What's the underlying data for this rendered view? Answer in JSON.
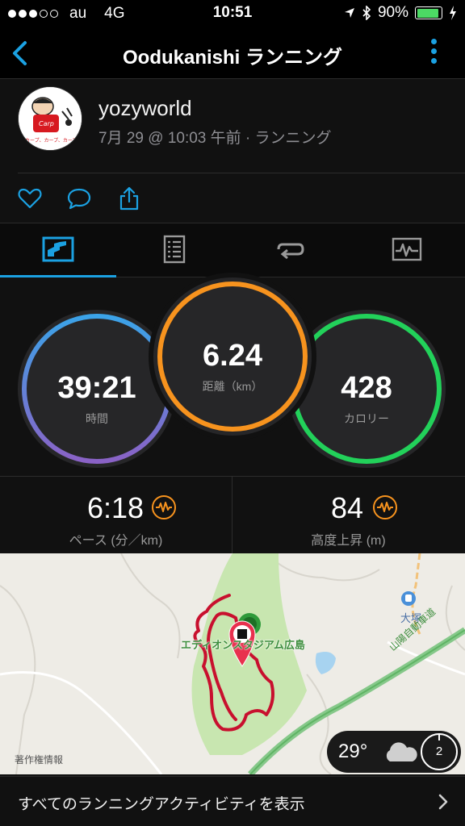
{
  "status_bar": {
    "carrier": "au",
    "network": "4G",
    "time": "10:51",
    "battery": "90%",
    "battery_level": 0.9
  },
  "nav": {
    "title": "Oodukanishi ランニング"
  },
  "activity": {
    "user": "yozyworld",
    "meta": "7月 29 @ 10:03 午前 · ランニング",
    "avatar_text": "カープ、カープ、カープ!!"
  },
  "tabs": [
    {
      "icon": "chart-icon"
    },
    {
      "icon": "splits-icon"
    },
    {
      "icon": "laps-icon"
    },
    {
      "icon": "graph-icon"
    }
  ],
  "rings": {
    "time": {
      "value": "39:21",
      "label": "時間"
    },
    "distance": {
      "value": "6.24",
      "label": "距離（km）"
    },
    "calories": {
      "value": "428",
      "label": "カロリー"
    }
  },
  "stats": {
    "pace": {
      "value": "6:18",
      "label": "ペース (分／km)"
    },
    "elevation": {
      "value": "84",
      "label": "高度上昇 (m)"
    }
  },
  "map": {
    "stadium_label": "エディオンスタジアム広島",
    "station_label": "大塚",
    "highway_label": "山陽自動車道",
    "copyright": "著作権情報",
    "weather_temp": "29°",
    "compass_value": "2"
  },
  "bottom": {
    "label": "すべてのランニングアクティビティを表示"
  },
  "colors": {
    "accent": "#1ba1e2",
    "time_ring": "#5aa0e8",
    "distance_ring": "#f7931e",
    "calorie_ring": "#22d15a",
    "route": "#c8102e",
    "park": "#c8e6b0"
  }
}
